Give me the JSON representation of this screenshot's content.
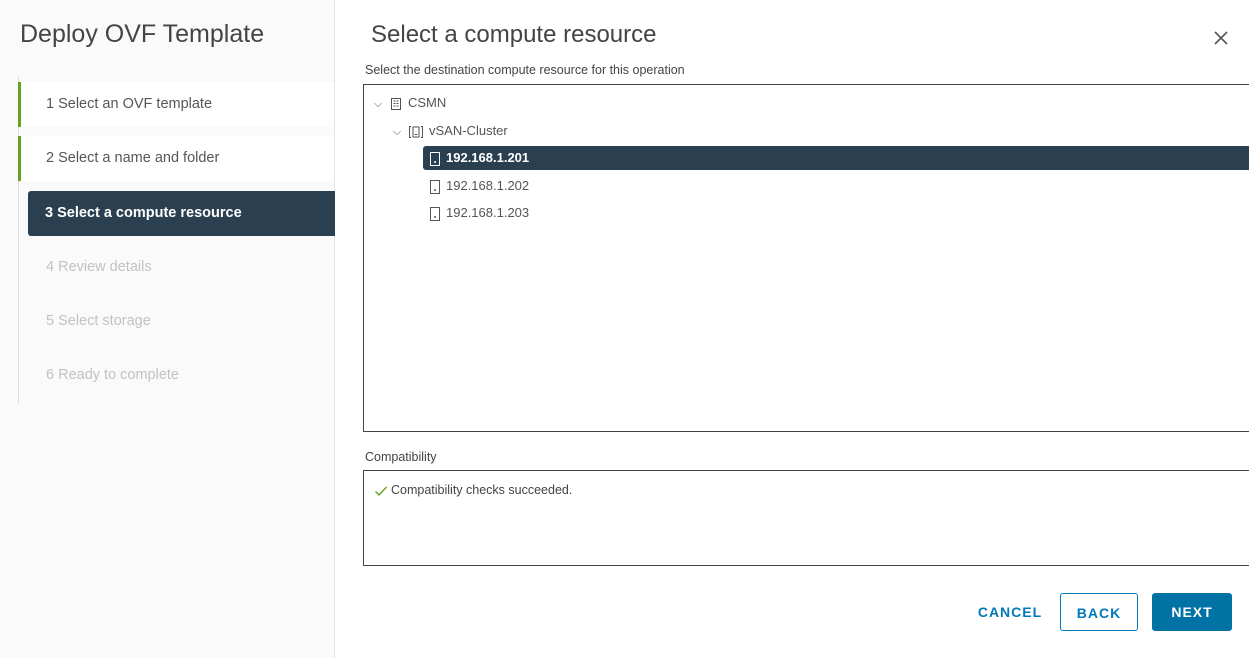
{
  "wizard": {
    "title": "Deploy OVF Template",
    "steps": [
      {
        "label": "1  Select an OVF template",
        "state": "done"
      },
      {
        "label": "2  Select a name and folder",
        "state": "done"
      },
      {
        "label": "3  Select a compute resource",
        "state": "active"
      },
      {
        "label": "4  Review details",
        "state": "todo"
      },
      {
        "label": "5  Select storage",
        "state": "todo"
      },
      {
        "label": "6  Ready to complete",
        "state": "todo"
      }
    ]
  },
  "main": {
    "title": "Select a compute resource",
    "subtitle": "Select the destination compute resource for this operation",
    "tree": {
      "datacenter": "CSMN",
      "cluster": "vSAN-Cluster",
      "hosts": [
        "192.168.1.201",
        "192.168.1.202",
        "192.168.1.203"
      ],
      "selected_host": "192.168.1.201"
    },
    "compatibility": {
      "label": "Compatibility",
      "message": "Compatibility checks succeeded."
    }
  },
  "buttons": {
    "cancel": "CANCEL",
    "back": "BACK",
    "next": "NEXT"
  },
  "colors": {
    "accent": "#0072a3",
    "selected_bg": "#2a4050",
    "done_bar": "#62a420",
    "success": "#62a420"
  }
}
